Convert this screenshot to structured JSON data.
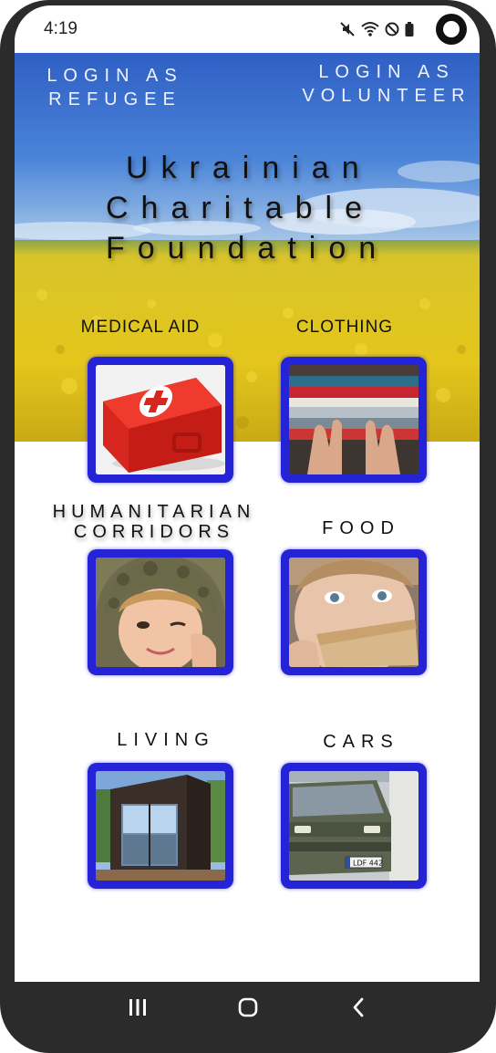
{
  "status_bar": {
    "time": "4:19",
    "icons": [
      "mute-icon",
      "wifi-icon",
      "dnd-icon",
      "battery-icon"
    ]
  },
  "header": {
    "login_refugee": "LOGIN AS REFUGEE",
    "login_volunteer": "LOGIN AS VOLUNTEER"
  },
  "title": {
    "line1": "Ukrainian",
    "line2": "Charitable",
    "line3": "Foundation"
  },
  "categories": [
    {
      "label": "MEDICAL AID",
      "image": "first-aid-kit"
    },
    {
      "label": "CLOTHING",
      "image": "folded-clothes"
    },
    {
      "label_line1": "HUMANITARIAN",
      "label_line2": "CORRIDORS",
      "image": "child-in-helmet"
    },
    {
      "label": "FOOD",
      "image": "child-eating-bread"
    },
    {
      "label": "LIVING",
      "image": "modular-house"
    },
    {
      "label": "CARS",
      "image": "green-van"
    }
  ],
  "nav_bar": {
    "icons": [
      "recent-apps-icon",
      "home-icon",
      "back-icon"
    ]
  },
  "colors": {
    "card_border": "#2424d6",
    "sky": "#3a6fd0",
    "field": "#e2c41a",
    "nav_bg": "#2b2b2b"
  }
}
